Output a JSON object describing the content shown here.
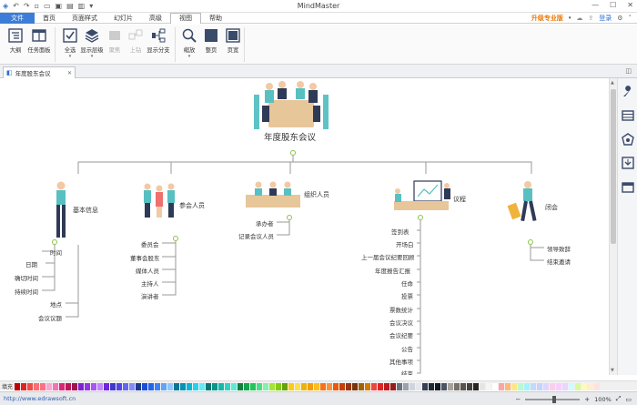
{
  "window": {
    "title": "MindMaster"
  },
  "menu": {
    "file": "文件",
    "tabs": [
      "首页",
      "页面样式",
      "幻灯片",
      "高级",
      "视图",
      "帮助"
    ],
    "active_tab": 4,
    "upgrade": "升级专业版",
    "login": "登录"
  },
  "ribbon": {
    "buttons": [
      {
        "label": "大纲",
        "icon": "outline-icon",
        "disabled": false
      },
      {
        "label": "任务面板",
        "icon": "task-panel-icon",
        "disabled": false
      },
      {
        "label": "全选",
        "icon": "select-all-icon",
        "disabled": false
      },
      {
        "label": "显示层级",
        "icon": "show-level-icon",
        "disabled": false
      },
      {
        "label": "聚焦",
        "icon": "focus-icon",
        "disabled": true
      },
      {
        "label": "上钻",
        "icon": "drill-up-icon",
        "disabled": true
      },
      {
        "label": "显示分支",
        "icon": "show-branch-icon",
        "disabled": false
      },
      {
        "label": "缩放",
        "icon": "zoom-icon",
        "disabled": false
      },
      {
        "label": "整页",
        "icon": "fit-page-icon",
        "disabled": false
      },
      {
        "label": "页宽",
        "icon": "page-width-icon",
        "disabled": false
      }
    ]
  },
  "document": {
    "tab": "年度股东会议"
  },
  "mindmap": {
    "central": "年度股东会议",
    "branches": [
      {
        "title": "基本信息",
        "items": [
          "时间",
          "日期",
          "确切时间",
          "持续时间",
          "地点",
          "会议议题"
        ]
      },
      {
        "title": "参会人员",
        "items": [
          "委员会",
          "董事会股东",
          "媒体人员",
          "主持人",
          "演讲者"
        ]
      },
      {
        "title": "组织人员",
        "items": [
          "承办者",
          "记录会议人员"
        ]
      },
      {
        "title": "议程",
        "items": [
          "签到表",
          "开场白",
          "上一届会议纪要回顾",
          "年度报告汇报",
          "任命",
          "投票",
          "票数统计",
          "会议决议",
          "会议纪要",
          "公告",
          "其他事项",
          "结束"
        ]
      },
      {
        "title": "闭会",
        "items": [
          "领导致辞",
          "结束邀请"
        ]
      }
    ]
  },
  "palette": {
    "label": "填充",
    "colors": [
      "#c00000",
      "#e02424",
      "#f04a4a",
      "#f87171",
      "#fb7185",
      "#f9a8d4",
      "#f472b6",
      "#db2777",
      "#be185d",
      "#9d174d",
      "#7e22ce",
      "#9333ea",
      "#a855f7",
      "#c084fc",
      "#6d28d9",
      "#4338ca",
      "#4f46e5",
      "#6366f1",
      "#818cf8",
      "#1e3a8a",
      "#1d4ed8",
      "#2563eb",
      "#3b82f6",
      "#60a5fa",
      "#93c5fd",
      "#0e7490",
      "#0891b2",
      "#06b6d4",
      "#22d3ee",
      "#67e8f9",
      "#0f766e",
      "#0d9488",
      "#14b8a6",
      "#2dd4bf",
      "#5eead4",
      "#15803d",
      "#16a34a",
      "#22c55e",
      "#4ade80",
      "#86efac",
      "#a3e635",
      "#84cc16",
      "#65a30d",
      "#facc15",
      "#fde047",
      "#eab308",
      "#f59e0b",
      "#fbbf24",
      "#f97316",
      "#fb923c",
      "#ea580c",
      "#c2410c",
      "#9a3412",
      "#78350f",
      "#a16207",
      "#d97706",
      "#ef4444",
      "#dc2626",
      "#b91c1c",
      "#991b1b",
      "#6b7280",
      "#9ca3af",
      "#d1d5db",
      "#e5e7eb",
      "#374151",
      "#1f2937",
      "#111827",
      "#4b5563",
      "#a8a29e",
      "#78716c",
      "#57534e",
      "#44403c",
      "#292524",
      "#e7e5e4",
      "#f5f5f4",
      "#ffffff",
      "#fca5a5",
      "#fdba74",
      "#fde68a",
      "#bbf7d0",
      "#a5f3fc",
      "#bfdbfe",
      "#c7d2fe",
      "#ddd6fe",
      "#fbcfe8",
      "#f5d0fe",
      "#e9d5ff",
      "#cffafe",
      "#d9f99d",
      "#fef9c3",
      "#ffedd5",
      "#fee2e2"
    ]
  },
  "status": {
    "url": "http://www.edrawsoft.cn",
    "zoom": "100%"
  }
}
